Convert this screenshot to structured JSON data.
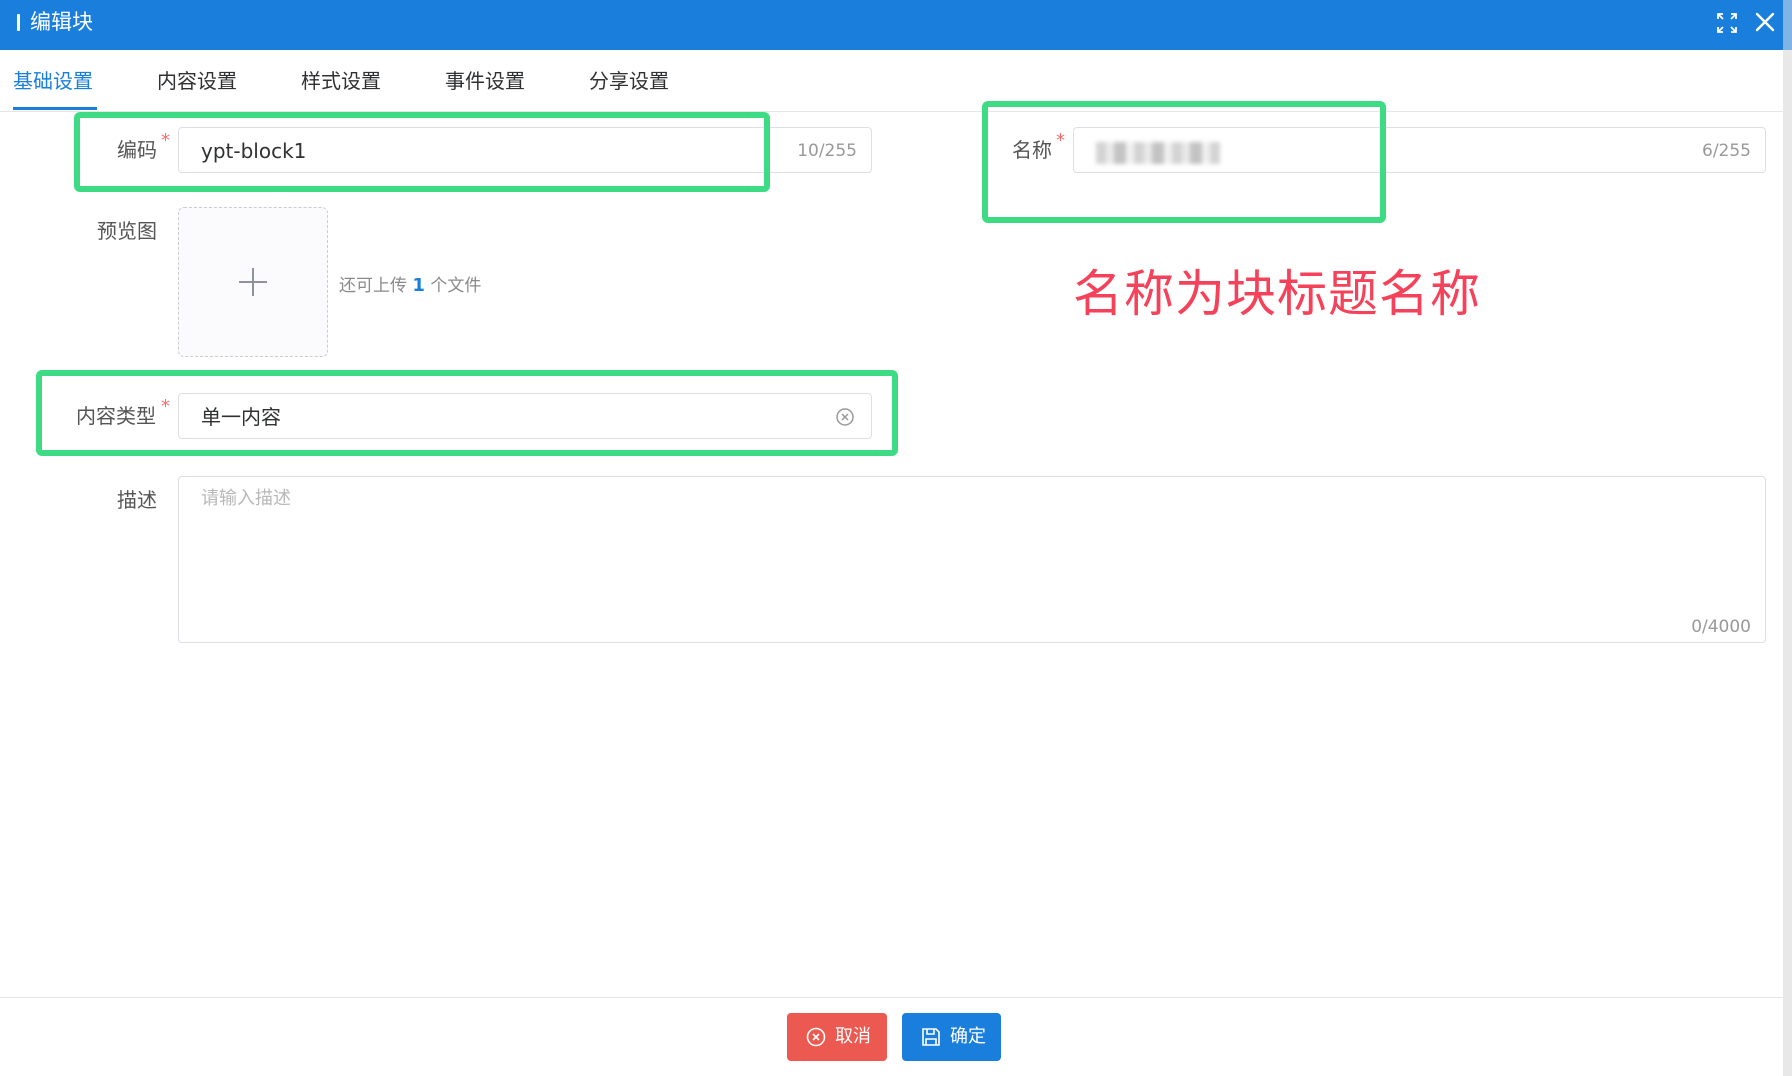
{
  "window": {
    "title": "编辑块"
  },
  "tabs": [
    {
      "label": "基础设置",
      "active": true
    },
    {
      "label": "内容设置"
    },
    {
      "label": "样式设置"
    },
    {
      "label": "事件设置"
    },
    {
      "label": "分享设置"
    }
  ],
  "form": {
    "code": {
      "label": "编码",
      "required": "*",
      "value": "ypt-block1",
      "count": "10/255"
    },
    "name": {
      "label": "名称",
      "required": "*",
      "value": "",
      "count": "6/255"
    },
    "preview": {
      "label": "预览图",
      "hint_prefix": "还可上传",
      "hint_count": "1",
      "hint_suffix": "个文件"
    },
    "content_type": {
      "label": "内容类型",
      "required": "*",
      "value": "单一内容"
    },
    "description": {
      "label": "描述",
      "placeholder": "请输入描述",
      "count": "0/4000"
    }
  },
  "annotation": {
    "text": "名称为块标题名称",
    "color": "#f5425a"
  },
  "footer": {
    "cancel_label": "取消",
    "confirm_label": "确定"
  },
  "colors": {
    "primary": "#1a7fdc",
    "danger": "#eb5950",
    "highlight": "#3ddc84"
  }
}
